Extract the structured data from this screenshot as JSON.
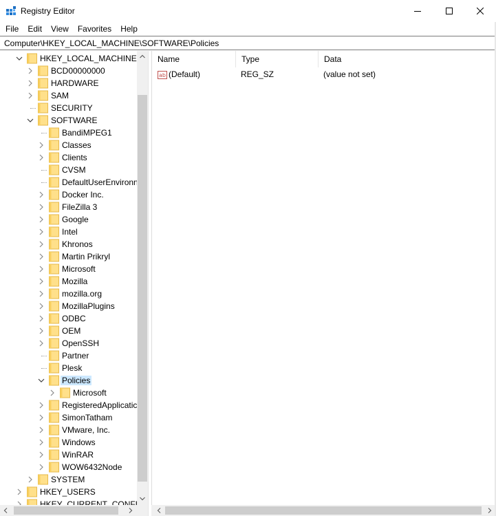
{
  "window": {
    "title": "Registry Editor",
    "icon": "regedit-icon",
    "controls": [
      "minimize-icon",
      "maximize-icon",
      "close-icon"
    ]
  },
  "menu": [
    "File",
    "Edit",
    "View",
    "Favorites",
    "Help"
  ],
  "address": "Computer\\HKEY_LOCAL_MACHINE\\SOFTWARE\\Policies",
  "tree": {
    "hklm": "HKEY_LOCAL_MACHINE",
    "hklm_children": [
      "BCD00000000",
      "HARDWARE",
      "SAM",
      "SECURITY",
      "SOFTWARE"
    ],
    "software_children": [
      "BandiMPEG1",
      "Classes",
      "Clients",
      "CVSM",
      "DefaultUserEnvironn",
      "Docker Inc.",
      "FileZilla 3",
      "Google",
      "Intel",
      "Khronos",
      "Martin Prikryl",
      "Microsoft",
      "Mozilla",
      "mozilla.org",
      "MozillaPlugins",
      "ODBC",
      "OEM",
      "OpenSSH",
      "Partner",
      "Plesk",
      "Policies"
    ],
    "policies_children": [
      "Microsoft"
    ],
    "software_after": [
      "RegisteredApplicatic",
      "SimonTatham",
      "VMware, Inc.",
      "Windows",
      "WinRAR",
      "WOW6432Node"
    ],
    "system": "SYSTEM",
    "hku": "HKEY_USERS",
    "hkcc": "HKEY_CURRENT_CONFIG",
    "selected": "Policies"
  },
  "list": {
    "columns": [
      "Name",
      "Type",
      "Data"
    ],
    "rows": [
      {
        "name": "(Default)",
        "type": "REG_SZ",
        "data": "(value not set)",
        "icon": "string-value-icon"
      }
    ]
  }
}
